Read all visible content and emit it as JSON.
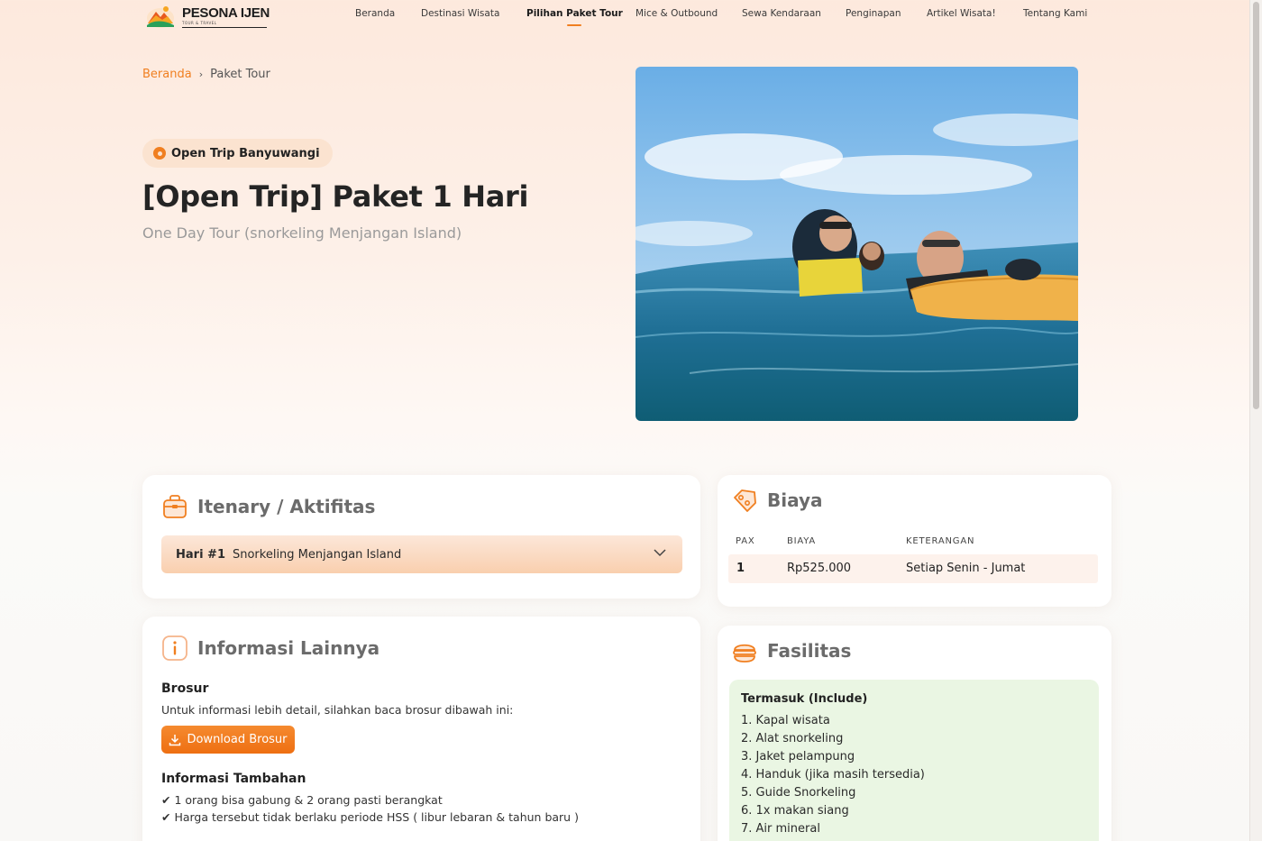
{
  "brand": {
    "name": "PESONA IJEN",
    "tagline": "TOUR & TRAVEL"
  },
  "nav": {
    "items": [
      {
        "label": "Beranda",
        "active": false
      },
      {
        "label": "Destinasi Wisata",
        "active": false
      },
      {
        "label": "Pilihan Paket Tour",
        "active": true
      },
      {
        "label": "Mice & Outbound",
        "active": false
      },
      {
        "label": "Sewa Kendaraan",
        "active": false
      },
      {
        "label": "Penginapan",
        "active": false
      },
      {
        "label": "Artikel Wisata!",
        "active": false
      },
      {
        "label": "Tentang Kami",
        "active": false
      }
    ]
  },
  "breadcrumb": {
    "home": "Beranda",
    "separator": "›",
    "current": "Paket Tour"
  },
  "hero": {
    "badge": "Open Trip Banyuwangi",
    "title": "[Open Trip] Paket 1 Hari",
    "subtitle": "One Day Tour (snorkeling Menjangan Island)"
  },
  "itinerary": {
    "title": "Itenary / Aktifitas",
    "day_label": "Hari #1",
    "day_activity": "Snorkeling Menjangan Island"
  },
  "biaya": {
    "title": "Biaya",
    "columns": [
      "PAX",
      "BIAYA",
      "KETERANGAN"
    ],
    "rows": [
      {
        "pax": "1",
        "biaya": "Rp525.000",
        "keterangan": "Setiap Senin - Jumat"
      }
    ]
  },
  "info": {
    "title": "Informasi Lainnya",
    "brosur_heading": "Brosur",
    "brosur_text": "Untuk informasi lebih detail, silahkan baca brosur dibawah ini:",
    "download_label": "Download Brosur",
    "tambahan_heading": "Informasi Tambahan",
    "tambahan_items": [
      "✔ 1 orang bisa gabung & 2 orang pasti berangkat",
      "✔ Harga tersebut tidak berlaku periode HSS ( libur lebaran & tahun baru )"
    ]
  },
  "fasilitas": {
    "title": "Fasilitas",
    "include_title": "Termasuk (Include)",
    "include_items": [
      "1. Kapal wisata",
      "2. Alat snorkeling",
      "3. Jaket pelampung",
      "4. Handuk (jika masih tersedia)",
      "5. Guide Snorkeling",
      "6. 1x makan siang",
      "7. Air mineral"
    ]
  },
  "colors": {
    "accent": "#f07f20",
    "include_bg": "#eaf6e3"
  },
  "icons": [
    "logo-mountain-icon",
    "location-pin-icon",
    "suitcase-icon",
    "chevron-down-icon",
    "price-tag-icon",
    "info-icon",
    "download-icon",
    "food-bowl-icon"
  ]
}
